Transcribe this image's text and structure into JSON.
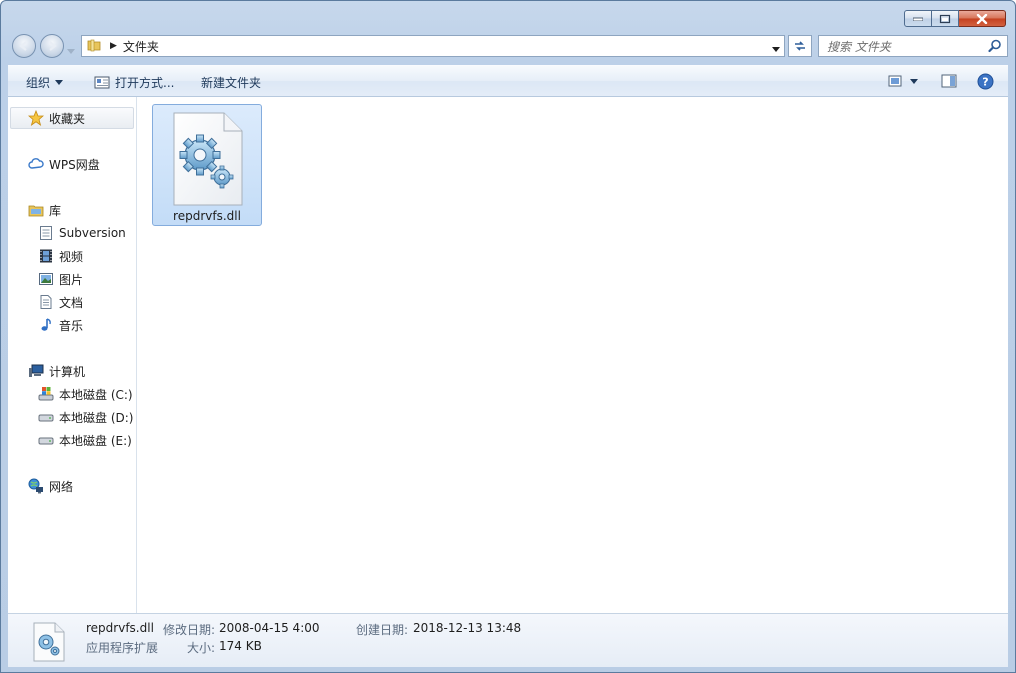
{
  "window": {
    "caption_buttons": [
      "minimize",
      "maximize",
      "close"
    ]
  },
  "address": {
    "crumb": "文件夹",
    "search_placeholder": "搜索 文件夹"
  },
  "toolbar": {
    "organize": "组织",
    "open_with": "打开方式...",
    "new_folder": "新建文件夹"
  },
  "sidebar": {
    "favorites": "收藏夹",
    "wps": "WPS网盘",
    "library": "库",
    "library_items": [
      "Subversion",
      "视频",
      "图片",
      "文档",
      "音乐"
    ],
    "computer": "计算机",
    "drives": [
      "本地磁盘 (C:)",
      "本地磁盘 (D:)",
      "本地磁盘 (E:)"
    ],
    "network": "网络"
  },
  "files": [
    {
      "name": "repdrvfs.dll",
      "icon": "dll-gear-file-icon"
    }
  ],
  "details": {
    "name": "repdrvfs.dll",
    "modified_label": "修改日期:",
    "modified_value": "2008-04-15 4:00",
    "created_label": "创建日期:",
    "created_value": "2018-12-13 13:48",
    "type": "应用程序扩展",
    "size_label": "大小:",
    "size_value": "174 KB"
  }
}
